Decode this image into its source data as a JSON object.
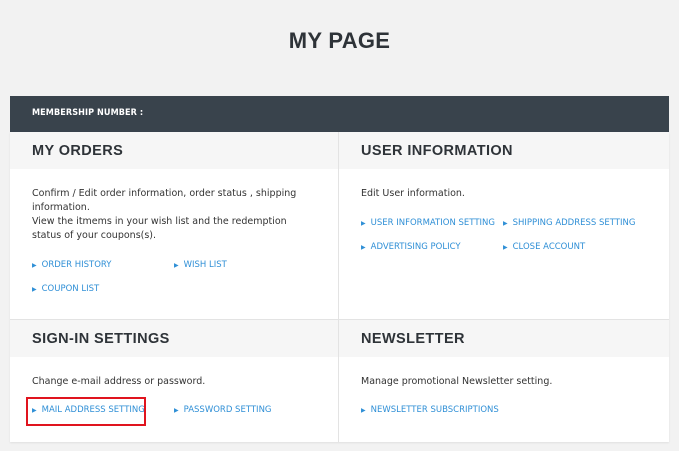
{
  "page": {
    "title": "MY PAGE"
  },
  "membership": {
    "label": "MEMBERSHIP NUMBER :"
  },
  "orders": {
    "title": "MY ORDERS",
    "description": "Confirm / Edit order information, order status , shipping information.\nView the itmems in your wish list and the redemption status of your coupons(s).",
    "links": [
      "ORDER HISTORY",
      "WISH LIST",
      "COUPON LIST"
    ]
  },
  "user_info": {
    "title": "USER INFORMATION",
    "description": "Edit User information.",
    "links": [
      "USER INFORMATION SETTING",
      "SHIPPING ADDRESS SETTING",
      "ADVERTISING POLICY",
      "CLOSE ACCOUNT"
    ]
  },
  "signin": {
    "title": "SIGN-IN SETTINGS",
    "description": "Change e-mail address or password.",
    "links": [
      "MAIL ADDRESS SETTING",
      "PASSWORD SETTING"
    ]
  },
  "newsletter": {
    "title": "NEWSLETTER",
    "description": "Manage promotional Newsletter setting.",
    "links": [
      "NEWSLETTER SUBSCRIPTIONS"
    ]
  },
  "icons": {
    "link_arrow": "triangle-right-icon"
  },
  "colors": {
    "header_bar": "#39434c",
    "link": "#2f8fd6",
    "highlight": "#e0141e"
  }
}
